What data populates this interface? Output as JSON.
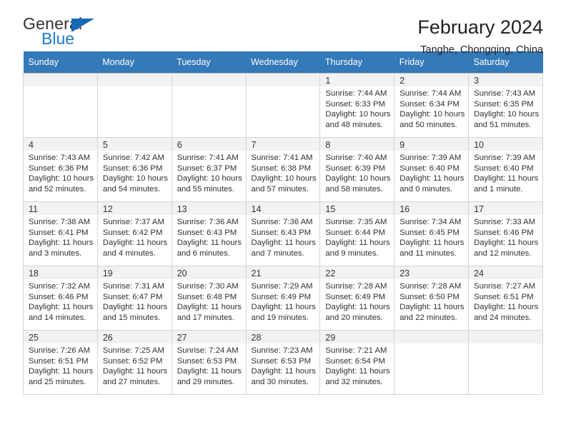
{
  "logo": {
    "word1": "General",
    "word2": "Blue",
    "triangle_color": "#1668b3",
    "blue_color": "#1f7ac4"
  },
  "header": {
    "title": "February 2024",
    "subtitle": "Tanghe, Chongqing, China"
  },
  "calendar": {
    "header_bg": "#3479b8",
    "header_text_color": "#ffffff",
    "daynum_bg": "#f2f2f2",
    "weekdays": [
      "Sunday",
      "Monday",
      "Tuesday",
      "Wednesday",
      "Thursday",
      "Friday",
      "Saturday"
    ],
    "weeks": [
      [
        {
          "day": "",
          "empty": true
        },
        {
          "day": "",
          "empty": true
        },
        {
          "day": "",
          "empty": true
        },
        {
          "day": "",
          "empty": true
        },
        {
          "day": "1",
          "sunrise": "Sunrise: 7:44 AM",
          "sunset": "Sunset: 6:33 PM",
          "daylight1": "Daylight: 10 hours",
          "daylight2": "and 48 minutes."
        },
        {
          "day": "2",
          "sunrise": "Sunrise: 7:44 AM",
          "sunset": "Sunset: 6:34 PM",
          "daylight1": "Daylight: 10 hours",
          "daylight2": "and 50 minutes."
        },
        {
          "day": "3",
          "sunrise": "Sunrise: 7:43 AM",
          "sunset": "Sunset: 6:35 PM",
          "daylight1": "Daylight: 10 hours",
          "daylight2": "and 51 minutes."
        }
      ],
      [
        {
          "day": "4",
          "sunrise": "Sunrise: 7:43 AM",
          "sunset": "Sunset: 6:36 PM",
          "daylight1": "Daylight: 10 hours",
          "daylight2": "and 52 minutes."
        },
        {
          "day": "5",
          "sunrise": "Sunrise: 7:42 AM",
          "sunset": "Sunset: 6:36 PM",
          "daylight1": "Daylight: 10 hours",
          "daylight2": "and 54 minutes."
        },
        {
          "day": "6",
          "sunrise": "Sunrise: 7:41 AM",
          "sunset": "Sunset: 6:37 PM",
          "daylight1": "Daylight: 10 hours",
          "daylight2": "and 55 minutes."
        },
        {
          "day": "7",
          "sunrise": "Sunrise: 7:41 AM",
          "sunset": "Sunset: 6:38 PM",
          "daylight1": "Daylight: 10 hours",
          "daylight2": "and 57 minutes."
        },
        {
          "day": "8",
          "sunrise": "Sunrise: 7:40 AM",
          "sunset": "Sunset: 6:39 PM",
          "daylight1": "Daylight: 10 hours",
          "daylight2": "and 58 minutes."
        },
        {
          "day": "9",
          "sunrise": "Sunrise: 7:39 AM",
          "sunset": "Sunset: 6:40 PM",
          "daylight1": "Daylight: 11 hours",
          "daylight2": "and 0 minutes."
        },
        {
          "day": "10",
          "sunrise": "Sunrise: 7:39 AM",
          "sunset": "Sunset: 6:40 PM",
          "daylight1": "Daylight: 11 hours",
          "daylight2": "and 1 minute."
        }
      ],
      [
        {
          "day": "11",
          "sunrise": "Sunrise: 7:38 AM",
          "sunset": "Sunset: 6:41 PM",
          "daylight1": "Daylight: 11 hours",
          "daylight2": "and 3 minutes."
        },
        {
          "day": "12",
          "sunrise": "Sunrise: 7:37 AM",
          "sunset": "Sunset: 6:42 PM",
          "daylight1": "Daylight: 11 hours",
          "daylight2": "and 4 minutes."
        },
        {
          "day": "13",
          "sunrise": "Sunrise: 7:36 AM",
          "sunset": "Sunset: 6:43 PM",
          "daylight1": "Daylight: 11 hours",
          "daylight2": "and 6 minutes."
        },
        {
          "day": "14",
          "sunrise": "Sunrise: 7:36 AM",
          "sunset": "Sunset: 6:43 PM",
          "daylight1": "Daylight: 11 hours",
          "daylight2": "and 7 minutes."
        },
        {
          "day": "15",
          "sunrise": "Sunrise: 7:35 AM",
          "sunset": "Sunset: 6:44 PM",
          "daylight1": "Daylight: 11 hours",
          "daylight2": "and 9 minutes."
        },
        {
          "day": "16",
          "sunrise": "Sunrise: 7:34 AM",
          "sunset": "Sunset: 6:45 PM",
          "daylight1": "Daylight: 11 hours",
          "daylight2": "and 11 minutes."
        },
        {
          "day": "17",
          "sunrise": "Sunrise: 7:33 AM",
          "sunset": "Sunset: 6:46 PM",
          "daylight1": "Daylight: 11 hours",
          "daylight2": "and 12 minutes."
        }
      ],
      [
        {
          "day": "18",
          "sunrise": "Sunrise: 7:32 AM",
          "sunset": "Sunset: 6:46 PM",
          "daylight1": "Daylight: 11 hours",
          "daylight2": "and 14 minutes."
        },
        {
          "day": "19",
          "sunrise": "Sunrise: 7:31 AM",
          "sunset": "Sunset: 6:47 PM",
          "daylight1": "Daylight: 11 hours",
          "daylight2": "and 15 minutes."
        },
        {
          "day": "20",
          "sunrise": "Sunrise: 7:30 AM",
          "sunset": "Sunset: 6:48 PM",
          "daylight1": "Daylight: 11 hours",
          "daylight2": "and 17 minutes."
        },
        {
          "day": "21",
          "sunrise": "Sunrise: 7:29 AM",
          "sunset": "Sunset: 6:49 PM",
          "daylight1": "Daylight: 11 hours",
          "daylight2": "and 19 minutes."
        },
        {
          "day": "22",
          "sunrise": "Sunrise: 7:28 AM",
          "sunset": "Sunset: 6:49 PM",
          "daylight1": "Daylight: 11 hours",
          "daylight2": "and 20 minutes."
        },
        {
          "day": "23",
          "sunrise": "Sunrise: 7:28 AM",
          "sunset": "Sunset: 6:50 PM",
          "daylight1": "Daylight: 11 hours",
          "daylight2": "and 22 minutes."
        },
        {
          "day": "24",
          "sunrise": "Sunrise: 7:27 AM",
          "sunset": "Sunset: 6:51 PM",
          "daylight1": "Daylight: 11 hours",
          "daylight2": "and 24 minutes."
        }
      ],
      [
        {
          "day": "25",
          "sunrise": "Sunrise: 7:26 AM",
          "sunset": "Sunset: 6:51 PM",
          "daylight1": "Daylight: 11 hours",
          "daylight2": "and 25 minutes."
        },
        {
          "day": "26",
          "sunrise": "Sunrise: 7:25 AM",
          "sunset": "Sunset: 6:52 PM",
          "daylight1": "Daylight: 11 hours",
          "daylight2": "and 27 minutes."
        },
        {
          "day": "27",
          "sunrise": "Sunrise: 7:24 AM",
          "sunset": "Sunset: 6:53 PM",
          "daylight1": "Daylight: 11 hours",
          "daylight2": "and 29 minutes."
        },
        {
          "day": "28",
          "sunrise": "Sunrise: 7:23 AM",
          "sunset": "Sunset: 6:53 PM",
          "daylight1": "Daylight: 11 hours",
          "daylight2": "and 30 minutes."
        },
        {
          "day": "29",
          "sunrise": "Sunrise: 7:21 AM",
          "sunset": "Sunset: 6:54 PM",
          "daylight1": "Daylight: 11 hours",
          "daylight2": "and 32 minutes."
        },
        {
          "day": "",
          "empty": true
        },
        {
          "day": "",
          "empty": true
        }
      ]
    ]
  }
}
